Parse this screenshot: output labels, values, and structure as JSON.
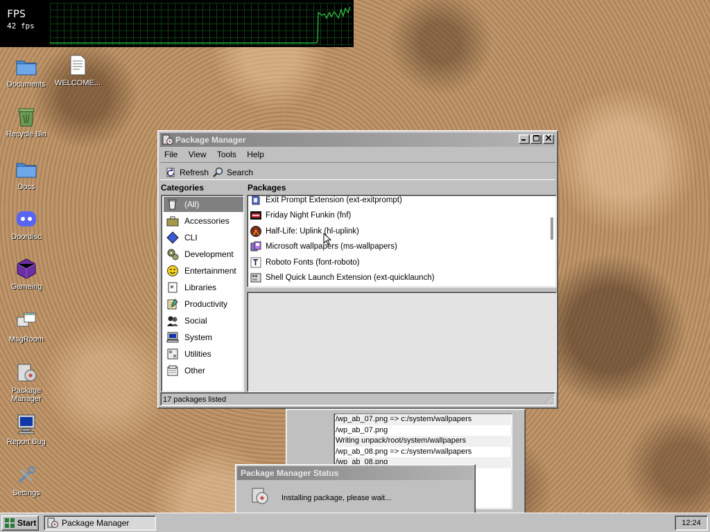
{
  "fps_overlay": {
    "title": "FPS",
    "value": "42 fps"
  },
  "desktop_icons": [
    {
      "label": "Documents",
      "icon": "folder-icon"
    },
    {
      "label": "WELCOME...",
      "icon": "text-file-icon"
    },
    {
      "label": "Recycle Bin",
      "icon": "recycle-bin-icon"
    },
    {
      "label": "Docs",
      "icon": "folder-icon"
    },
    {
      "label": "Doordisc",
      "icon": "discord-icon"
    },
    {
      "label": "Gameing",
      "icon": "purple-cube-icon"
    },
    {
      "label": "MsgRoom",
      "icon": "chat-windows-icon"
    },
    {
      "label": "Package Manager",
      "icon": "package-manager-icon"
    },
    {
      "label": "Report Bug",
      "icon": "computer-icon"
    },
    {
      "label": "Settings",
      "icon": "tools-icon"
    }
  ],
  "window": {
    "title": "Package Manager",
    "menu": [
      "File",
      "View",
      "Tools",
      "Help"
    ],
    "toolbar": {
      "refresh_label": "Refresh",
      "search_label": "Search"
    },
    "categories_header": "Categories",
    "packages_header": "Packages",
    "categories": [
      {
        "label": "(All)",
        "icon": "all-icon",
        "selected": true
      },
      {
        "label": "Accessories",
        "icon": "briefcase-icon"
      },
      {
        "label": "CLI",
        "icon": "diamond-icon"
      },
      {
        "label": "Development",
        "icon": "gears-icon"
      },
      {
        "label": "Entertainment",
        "icon": "smiley-icon"
      },
      {
        "label": "Libraries",
        "icon": "book-icon"
      },
      {
        "label": "Productivity",
        "icon": "notepad-icon"
      },
      {
        "label": "Social",
        "icon": "people-icon"
      },
      {
        "label": "System",
        "icon": "computer-icon"
      },
      {
        "label": "Utilities",
        "icon": "utilities-icon"
      },
      {
        "label": "Other",
        "icon": "other-icon"
      }
    ],
    "packages": [
      {
        "label": "Exit Prompt Extension (ext-exitprompt)",
        "icon": "extension-icon"
      },
      {
        "label": "Friday Night Funkin (fnf)",
        "icon": "fnf-icon"
      },
      {
        "label": "Half-Life: Uplink (hl-uplink)",
        "icon": "half-life-icon"
      },
      {
        "label": "Microsoft wallpapers (ms-wallpapers)",
        "icon": "wallpaper-icon"
      },
      {
        "label": "Roboto Fonts (font-roboto)",
        "icon": "font-icon"
      },
      {
        "label": "Shell Quick Launch Extension (ext-quicklaunch)",
        "icon": "extension-icon"
      }
    ],
    "status_text": "17 packages listed"
  },
  "console_log": [
    "/wp_ab_07.png => c:/system/wallpapers",
    "/wp_ab_07.png",
    "Writing unpack/root/system/wallpapers",
    "/wp_ab_08.png => c:/system/wallpapers",
    "/wp_ab_08.png"
  ],
  "status_dialog": {
    "title": "Package Manager Status",
    "message": "Installing package, please wait..."
  },
  "taskbar": {
    "start_label": "Start",
    "task_label": "Package Manager",
    "clock": "12:24"
  }
}
